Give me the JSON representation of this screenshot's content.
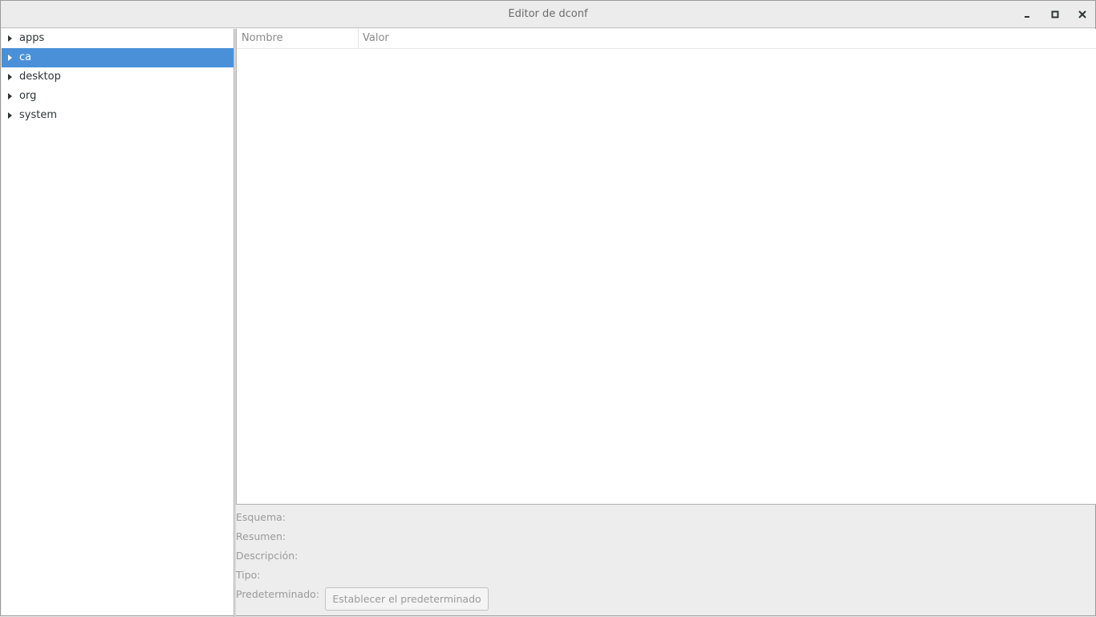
{
  "window": {
    "title": "Editor de dconf"
  },
  "tree": {
    "items": [
      {
        "label": "apps",
        "selected": false
      },
      {
        "label": "ca",
        "selected": true
      },
      {
        "label": "desktop",
        "selected": false
      },
      {
        "label": "org",
        "selected": false
      },
      {
        "label": "system",
        "selected": false
      }
    ]
  },
  "keys_table": {
    "columns": [
      "Nombre",
      "Valor"
    ],
    "rows": []
  },
  "details": {
    "schema_label": "Esquema:",
    "summary_label": "Resumen:",
    "description_label": "Descripción:",
    "type_label": "Tipo:",
    "default_label": "Predeterminado:",
    "set_default_button": "Establecer el predeterminado"
  },
  "colors": {
    "selection": "#4a90d9",
    "window_bg": "#ededed"
  },
  "icons": {
    "minimize": "minimize-icon",
    "maximize": "maximize-icon",
    "close": "close-icon",
    "expander": "triangle-right-icon"
  }
}
